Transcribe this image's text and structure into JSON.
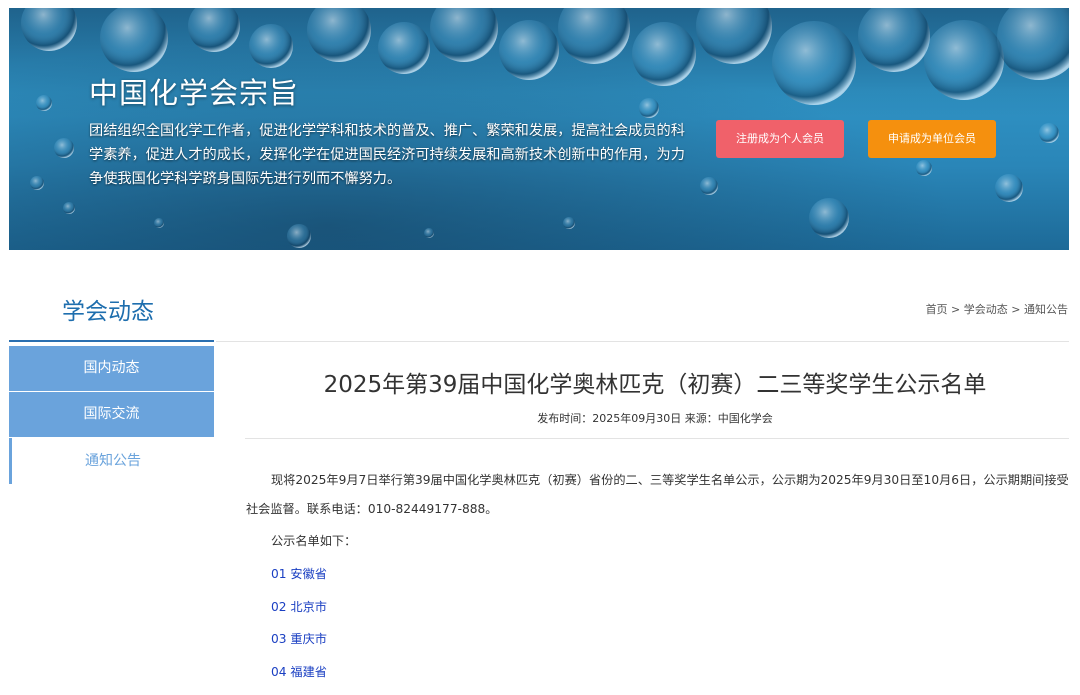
{
  "banner": {
    "title": "中国化学会宗旨",
    "description": "团结组织全国化学工作者，促进化学学科和技术的普及、推广、繁荣和发展，提高社会成员的科学素养，促进人才的成长，发挥化学在促进国民经济可持续发展和高新技术创新中的作用，为力争使我国化学科学跻身国际先进行列而不懈努力。",
    "personal_member_button": "注册成为个人会员",
    "unit_member_button": "申请成为单位会员"
  },
  "section": {
    "title": "学会动态"
  },
  "breadcrumb": {
    "home": "首页",
    "separator": " > ",
    "level1": "学会动态",
    "level2": "通知公告"
  },
  "sidebar": {
    "items": [
      {
        "label": "国内动态"
      },
      {
        "label": "国际交流"
      },
      {
        "label": "通知公告"
      }
    ]
  },
  "article": {
    "title": "2025年第39届中国化学奥林匹克（初赛）二三等奖学生公示名单",
    "meta": "发布时间：2025年09月30日 来源：中国化学会",
    "paragraph": "现将2025年9月7日举行第39届中国化学奥林匹克（初赛）省份的二、三等奖学生名单公示，公示期为2025年9月30日至10月6日，公示期期间接受社会监督。联系电话：010-82449177-888。",
    "list_intro": "公示名单如下：",
    "list": [
      {
        "label": "01 安徽省"
      },
      {
        "label": "02 北京市"
      },
      {
        "label": "03 重庆市"
      },
      {
        "label": "04 福建省"
      }
    ]
  },
  "colors": {
    "accent_blue": "#1e6eae",
    "sidebar_blue": "#6aa3dc",
    "button_red": "#f0616a",
    "button_orange": "#f5900e",
    "link_blue": "#1a3fc2"
  }
}
